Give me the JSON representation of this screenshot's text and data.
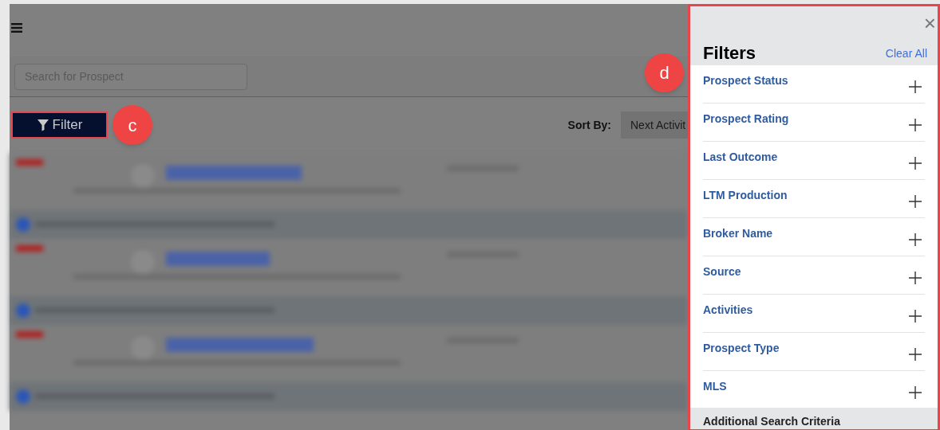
{
  "search": {
    "placeholder": "Search for Prospect"
  },
  "filter_button": {
    "label": "Filter"
  },
  "callouts": [
    {
      "label": "c"
    },
    {
      "label": "d"
    }
  ],
  "sort": {
    "label": "Sort By:",
    "value": "Next Activit"
  },
  "filters_panel": {
    "title": "Filters",
    "clear_all": "Clear All",
    "close": "×",
    "items": [
      {
        "kind": "filter",
        "label": "Prospect Status",
        "expanded": false
      },
      {
        "kind": "filter",
        "label": "Prospect Rating",
        "expanded": false
      },
      {
        "kind": "filter",
        "label": "Last Outcome",
        "expanded": false
      },
      {
        "kind": "filter",
        "label": "LTM Production",
        "expanded": false
      },
      {
        "kind": "filter",
        "label": "Broker Name",
        "expanded": false
      },
      {
        "kind": "filter",
        "label": "Source",
        "expanded": false
      },
      {
        "kind": "filter",
        "label": "Activities",
        "expanded": false
      },
      {
        "kind": "filter",
        "label": "Prospect Type",
        "expanded": false
      },
      {
        "kind": "filter",
        "label": "MLS",
        "expanded": false
      },
      {
        "kind": "section",
        "label": "Additional Search Criteria"
      }
    ]
  }
}
